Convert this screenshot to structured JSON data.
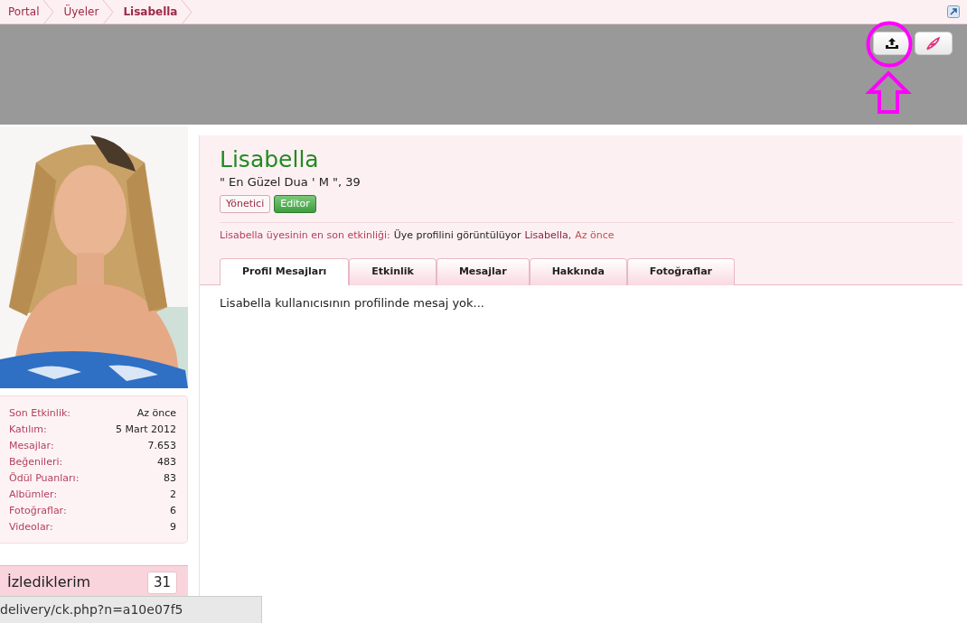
{
  "breadcrumbs": [
    {
      "label": "Portal",
      "current": false
    },
    {
      "label": "Üyeler",
      "current": false
    },
    {
      "label": "Lisabella",
      "current": true
    }
  ],
  "header_buttons": [
    {
      "kind": "upload",
      "highlighted": true
    },
    {
      "kind": "edit",
      "highlighted": false
    }
  ],
  "sidebar": {
    "stats": [
      {
        "label": "Son Etkinlik:",
        "value": "Az önce"
      },
      {
        "label": "Katılım:",
        "value": "5 Mart 2012"
      },
      {
        "label": "Mesajlar:",
        "value": "7.653"
      },
      {
        "label": "Beğenileri:",
        "value": "483"
      },
      {
        "label": "Ödül Puanları:",
        "value": "83"
      },
      {
        "label": "Albümler:",
        "value": "2"
      },
      {
        "label": "Fotoğraflar:",
        "value": "6"
      },
      {
        "label": "Videolar:",
        "value": "9"
      }
    ],
    "following": {
      "label": "İzlediklerim",
      "count": "31"
    }
  },
  "profile": {
    "name": "Lisabella",
    "subtitle": "\" En Güzel Dua ' M \", 39",
    "badges": [
      {
        "label": "Yönetici",
        "kind": "title"
      },
      {
        "label": "Editor",
        "kind": "role"
      }
    ],
    "activity": [
      {
        "text": "Lisabella üyesinin en son etkinliği:",
        "kind": "label"
      },
      {
        "text": "Üye profilini görüntülüyor",
        "kind": "plain"
      },
      {
        "text": "Lisabella,",
        "kind": "link"
      },
      {
        "text": "Az önce",
        "kind": "time"
      }
    ]
  },
  "tabs": [
    {
      "label": "Profil Mesajları",
      "selected": true
    },
    {
      "label": "Etkinlik",
      "selected": false
    },
    {
      "label": "Mesajlar",
      "selected": false
    },
    {
      "label": "Hakkında",
      "selected": false
    },
    {
      "label": "Fotoğraflar",
      "selected": false
    }
  ],
  "empty_message": "Lisabella kullanıcısının profilinde mesaj yok...",
  "status_bar": "delivery/ck.php?n=a10e07f5"
}
